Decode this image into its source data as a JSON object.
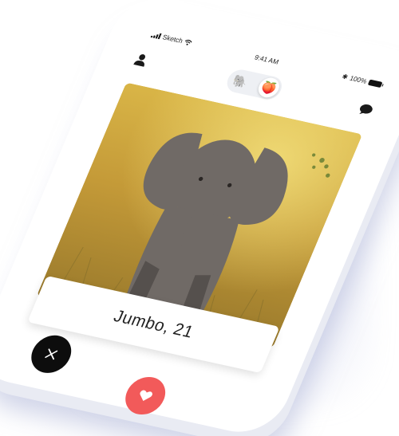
{
  "status_bar": {
    "carrier": "Sketch",
    "time": "9:41 AM",
    "battery": "100%"
  },
  "header": {
    "profile_icon": "user-icon",
    "messages_icon": "chat-bubble-icon",
    "mode_toggle": {
      "options": [
        "elephant-icon",
        "peach-icon"
      ],
      "selected": "peach-icon"
    }
  },
  "profile_card": {
    "photo": "baby-elephant-photo",
    "name_age": "Jumbo, 21"
  },
  "actions": {
    "dislike_icon": "close-icon",
    "like_icon": "heart-icon",
    "like_color": "#f25a5a",
    "dislike_color": "#0d0d0d"
  }
}
